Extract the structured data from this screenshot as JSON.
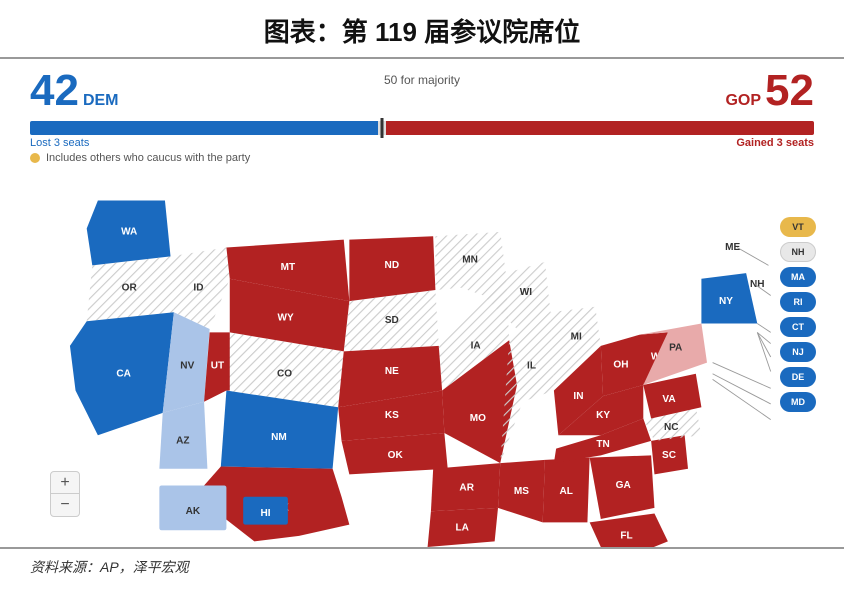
{
  "title": "图表：第 119 届参议院席位",
  "scoreboard": {
    "dem_number": "42",
    "dem_label": "DEM",
    "gop_number": "52",
    "gop_label": "GOP",
    "majority_label": "50 for majority",
    "lost_seats": "Lost 3 seats",
    "gained_seats": "Gained 3 seats",
    "caucus_note": "Includes others who caucus with the party"
  },
  "footer": "资料来源：AP，泽平宏观",
  "zoom_plus": "+",
  "zoom_minus": "−",
  "small_states": [
    {
      "abbr": "VT",
      "party": "caucus"
    },
    {
      "abbr": "NH",
      "party": "none"
    },
    {
      "abbr": "MA",
      "party": "dem"
    },
    {
      "abbr": "RI",
      "party": "dem"
    },
    {
      "abbr": "CT",
      "party": "dem"
    },
    {
      "abbr": "NJ",
      "party": "dem"
    },
    {
      "abbr": "DE",
      "party": "dem"
    },
    {
      "abbr": "MD",
      "party": "dem"
    }
  ]
}
